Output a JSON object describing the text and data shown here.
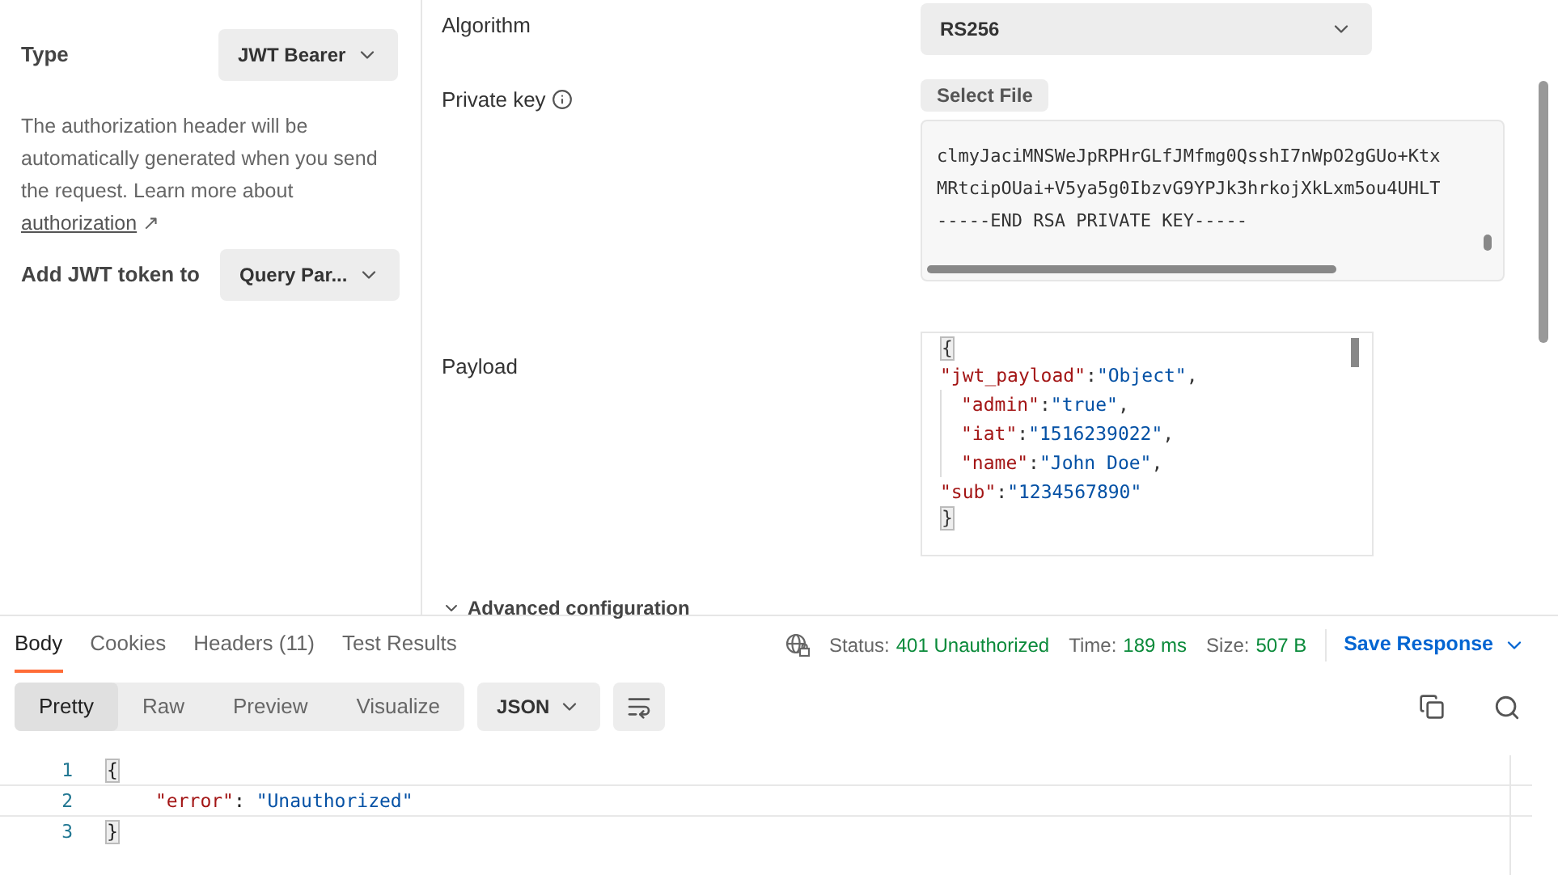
{
  "auth": {
    "type_label": "Type",
    "type_value": "JWT Bearer",
    "description": "The authorization header will be automatically generated when you send the request. Learn more about",
    "link": "authorization",
    "link_arrow": "↗",
    "add_to_label": "Add JWT token to",
    "add_to_value": "Query Par..."
  },
  "config": {
    "algorithm_label": "Algorithm",
    "algorithm_value": "RS256",
    "private_key_label": "Private key",
    "select_file": "Select File",
    "key_lines": [
      "clmyJaciMNSWeJpRPHrGLfJMfmg0QsshI7nWpO2gGUo+Ktx",
      "MRtcipOUai+V5ya5g0IbzvG9YPJk3hrkojXkLxm5ou4UHLT",
      "-----END RSA PRIVATE KEY-----"
    ],
    "payload_label": "Payload",
    "payload": {
      "open": "{",
      "close": "}",
      "lines": [
        {
          "key": "\"jwt_payload\"",
          "sep": ":",
          "value": "\"Object\"",
          "trail": ",",
          "children": [
            {
              "key": "\"admin\"",
              "sep": ":",
              "value": "\"true\"",
              "trail": ","
            },
            {
              "key": "\"iat\"",
              "sep": ":",
              "value": "\"1516239022\"",
              "trail": ","
            },
            {
              "key": "\"name\"",
              "sep": ":",
              "value": "\"John Doe\"",
              "trail": ","
            }
          ]
        },
        {
          "key": "\"sub\"",
          "sep": ":",
          "value": "\"1234567890\""
        }
      ]
    },
    "advanced": "Advanced configuration"
  },
  "response": {
    "tabs": [
      {
        "label": "Body",
        "selected": true
      },
      {
        "label": "Cookies",
        "selected": false
      },
      {
        "label": "Headers (11)",
        "selected": false
      },
      {
        "label": "Test Results",
        "selected": false
      }
    ],
    "status_label": "Status:",
    "status_value": "401 Unauthorized",
    "time_label": "Time:",
    "time_value": "189 ms",
    "size_label": "Size:",
    "size_value": "507 B",
    "save": "Save Response",
    "views": [
      {
        "label": "Pretty",
        "selected": true
      },
      {
        "label": "Raw",
        "selected": false
      },
      {
        "label": "Preview",
        "selected": false
      },
      {
        "label": "Visualize",
        "selected": false
      }
    ],
    "format": "JSON",
    "code": [
      {
        "number": "1",
        "kind": "open",
        "text": "{"
      },
      {
        "number": "2",
        "kind": "pair",
        "key": "\"error\"",
        "sep": ": ",
        "value": "\"Unauthorized\""
      },
      {
        "number": "3",
        "kind": "close",
        "text": "}"
      }
    ]
  }
}
